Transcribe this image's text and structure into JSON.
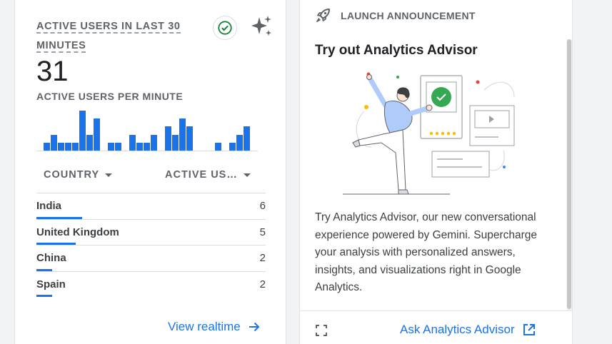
{
  "realtime": {
    "title": "ACTIVE USERS IN LAST 30 MINUTES",
    "count": "31",
    "per_minute_label": "ACTIVE USERS PER MINUTE",
    "per_minute_values": [
      1,
      2,
      1,
      1,
      1,
      5,
      2,
      4,
      0,
      1,
      1,
      0,
      2,
      1,
      1,
      2,
      0,
      3,
      2,
      4,
      3,
      0,
      0,
      0,
      1,
      0,
      1,
      2,
      3
    ],
    "columns": {
      "country": "COUNTRY",
      "active": "ACTIVE US…"
    },
    "rows": [
      {
        "country": "India",
        "value": "6",
        "share": 0.2
      },
      {
        "country": "United Kingdom",
        "value": "5",
        "share": 0.17
      },
      {
        "country": "China",
        "value": "2",
        "share": 0.07
      },
      {
        "country": "Spain",
        "value": "2",
        "share": 0.07
      }
    ],
    "view_link": "View realtime"
  },
  "advisor": {
    "badge": "LAUNCH ANNOUNCEMENT",
    "title": "Try out Analytics Advisor",
    "body": "Try Analytics Advisor, our new conversational experience powered by Gemini. Supercharge your analysis with personalized answers, insights, and visualizations right in Google Analytics.",
    "cta": "Ask Analytics Advisor"
  },
  "colors": {
    "accent": "#1a73e8",
    "success": "#188038",
    "muted": "#5f6368"
  }
}
